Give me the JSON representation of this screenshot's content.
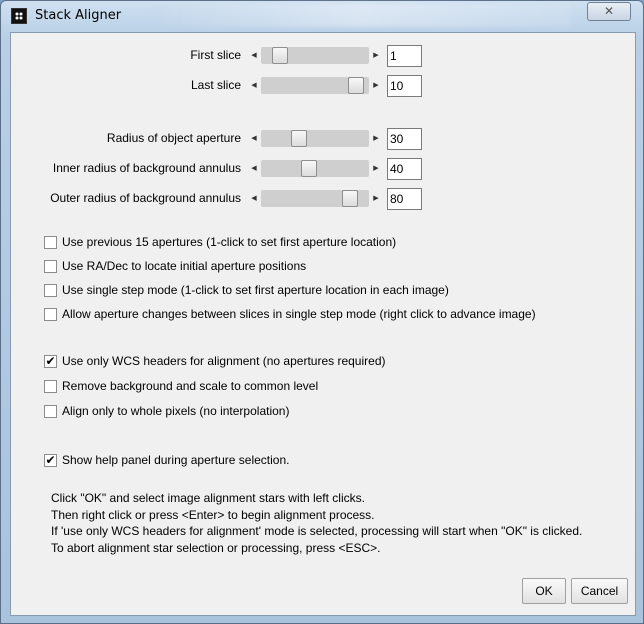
{
  "window": {
    "title": "Stack Aligner",
    "close_symbol": "✕"
  },
  "sliders": [
    {
      "label": "First slice",
      "value": "1",
      "position": 0.12
    },
    {
      "label": "Last slice",
      "value": "10",
      "position": 0.95
    },
    {
      "label": "Radius of object aperture",
      "value": "30",
      "position": 0.33
    },
    {
      "label": "Inner radius of background annulus",
      "value": "40",
      "position": 0.44
    },
    {
      "label": "Outer radius of background annulus",
      "value": "80",
      "position": 0.88
    }
  ],
  "checkboxes": [
    {
      "label": "Use previous 15 apertures (1-click to set first aperture location)",
      "checked": false
    },
    {
      "label": "Use RA/Dec to locate initial aperture positions",
      "checked": false
    },
    {
      "label": "Use single step mode (1-click to set first aperture location in each image)",
      "checked": false
    },
    {
      "label": "Allow aperture changes between slices in single step mode (right click to advance image)",
      "checked": false
    },
    {
      "label": "Use only WCS headers for alignment (no apertures required)",
      "checked": true
    },
    {
      "label": "Remove background and scale to common level",
      "checked": false
    },
    {
      "label": "Align only to whole pixels (no interpolation)",
      "checked": false
    },
    {
      "label": "Show help panel during aperture selection.",
      "checked": true
    }
  ],
  "help_lines": [
    "Click \"OK\" and select image alignment stars with left clicks.",
    "Then right click or press <Enter> to begin alignment process.",
    "If 'use only WCS headers for alignment' mode is selected, processing will start when \"OK\" is clicked.",
    "To abort alignment star selection or processing, press <ESC>."
  ],
  "buttons": {
    "ok": "OK",
    "cancel": "Cancel"
  },
  "glyphs": {
    "arrow_left": "◀",
    "arrow_right": "▶",
    "check": "✔"
  }
}
